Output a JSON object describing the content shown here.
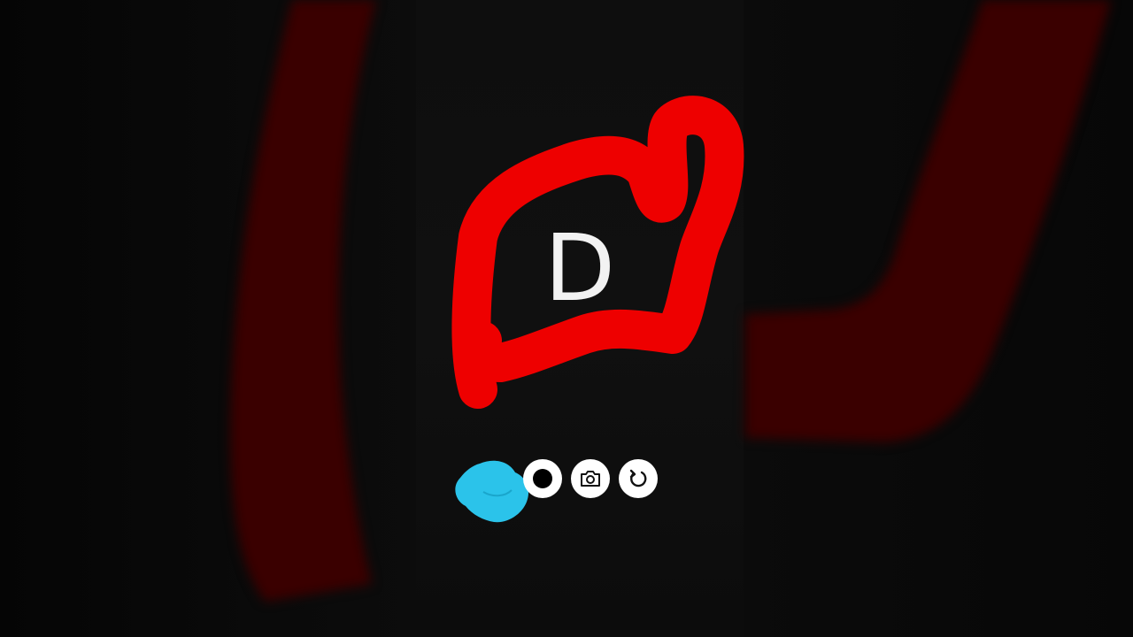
{
  "canvas": {
    "letter": "D",
    "stroke_color": "#ee0000",
    "background_stroke_color": "#3a0000",
    "background_color": "#080808"
  },
  "toolbar": {
    "selected_color": "#2bc3ea",
    "buttons": [
      {
        "name": "record-button",
        "icon": "record-icon"
      },
      {
        "name": "camera-button",
        "icon": "camera-icon"
      },
      {
        "name": "undo-button",
        "icon": "undo-icon"
      }
    ]
  }
}
